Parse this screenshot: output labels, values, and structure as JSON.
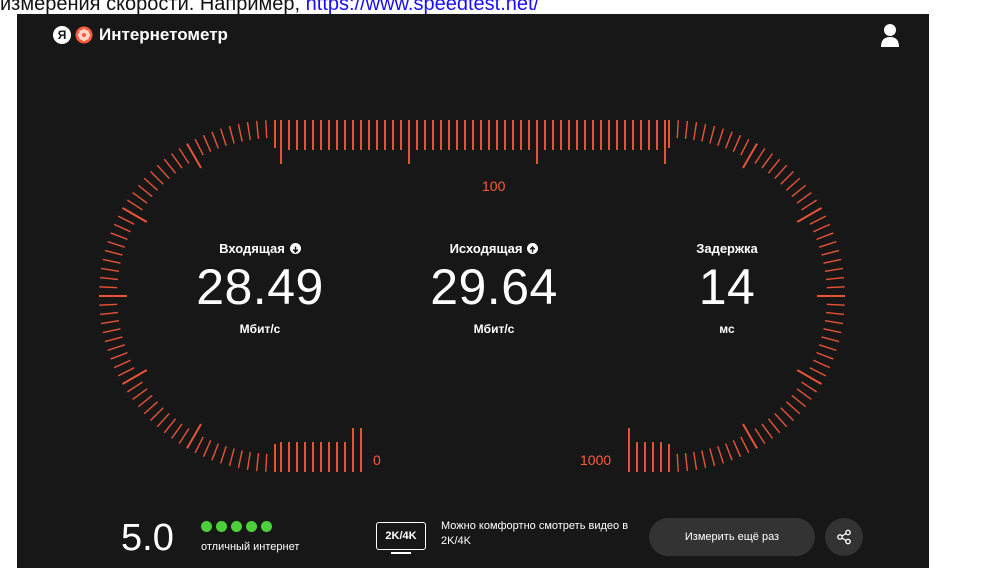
{
  "caption": {
    "text": "измерения скорости. Например, ",
    "link": "https://www.speedtest.net/"
  },
  "header": {
    "logo_letter": "Я",
    "title": "Интернетометр",
    "avatar_icon": "user-icon"
  },
  "gauge": {
    "accent_color": "#ff5a3c",
    "scale_labels": {
      "zero": "0",
      "hundred": "100",
      "thousand": "1000"
    }
  },
  "metrics": {
    "download": {
      "label": "Входящая",
      "value": "28.49",
      "unit": "Мбит/с",
      "icon": "download-icon"
    },
    "upload": {
      "label": "Исходящая",
      "value": "29.64",
      "unit": "Мбит/с",
      "icon": "upload-icon"
    },
    "latency": {
      "label": "Задержка",
      "value": "14",
      "unit": "мс"
    }
  },
  "footer": {
    "rating_score": "5.0",
    "rating_dots": 5,
    "rating_color": "#4ccf3a",
    "rating_text": "отличный интернет",
    "quality_badge": "2K/4K",
    "quality_text": "Можно комфортно смотреть видео в 2K/4K",
    "retry_label": "Измерить ещё раз",
    "share_icon": "share-icon"
  }
}
